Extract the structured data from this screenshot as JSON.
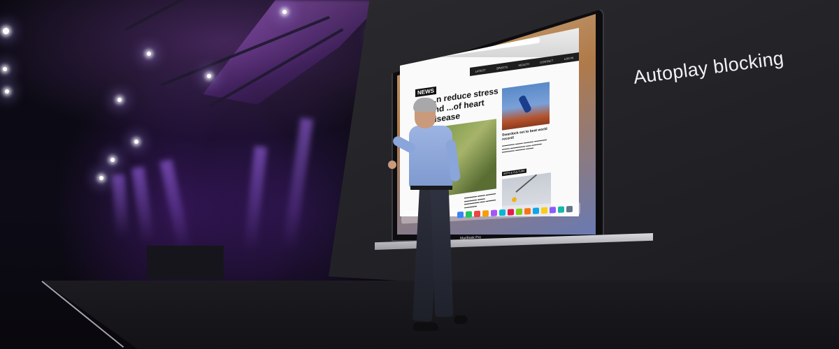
{
  "slide": {
    "title": "Autoplay blocking"
  },
  "laptop": {
    "model_label": "MacBook Pro",
    "browser": {
      "site_logo": "NEWS",
      "nav_items": [
        "LATEST",
        "SPORTS",
        "HEALTH",
        "CONTACT",
        "LOG IN"
      ],
      "headline": "...n reduce stress and ...of heart disease",
      "side_story_title": "Swardock set to beat world record!",
      "side_tag": "ARTS & CULTURE"
    },
    "dock_icon_colors": [
      "#3b82f6",
      "#22c55e",
      "#ef4444",
      "#f59e0b",
      "#a855f7",
      "#06b6d4",
      "#e11d48",
      "#84cc16",
      "#f97316",
      "#0ea5e9",
      "#facc15",
      "#8b5cf6",
      "#14b8a6",
      "#64748b"
    ]
  },
  "stage": {
    "accent_purple": "#8a3fe0",
    "backdrop_color": "#26262a"
  }
}
